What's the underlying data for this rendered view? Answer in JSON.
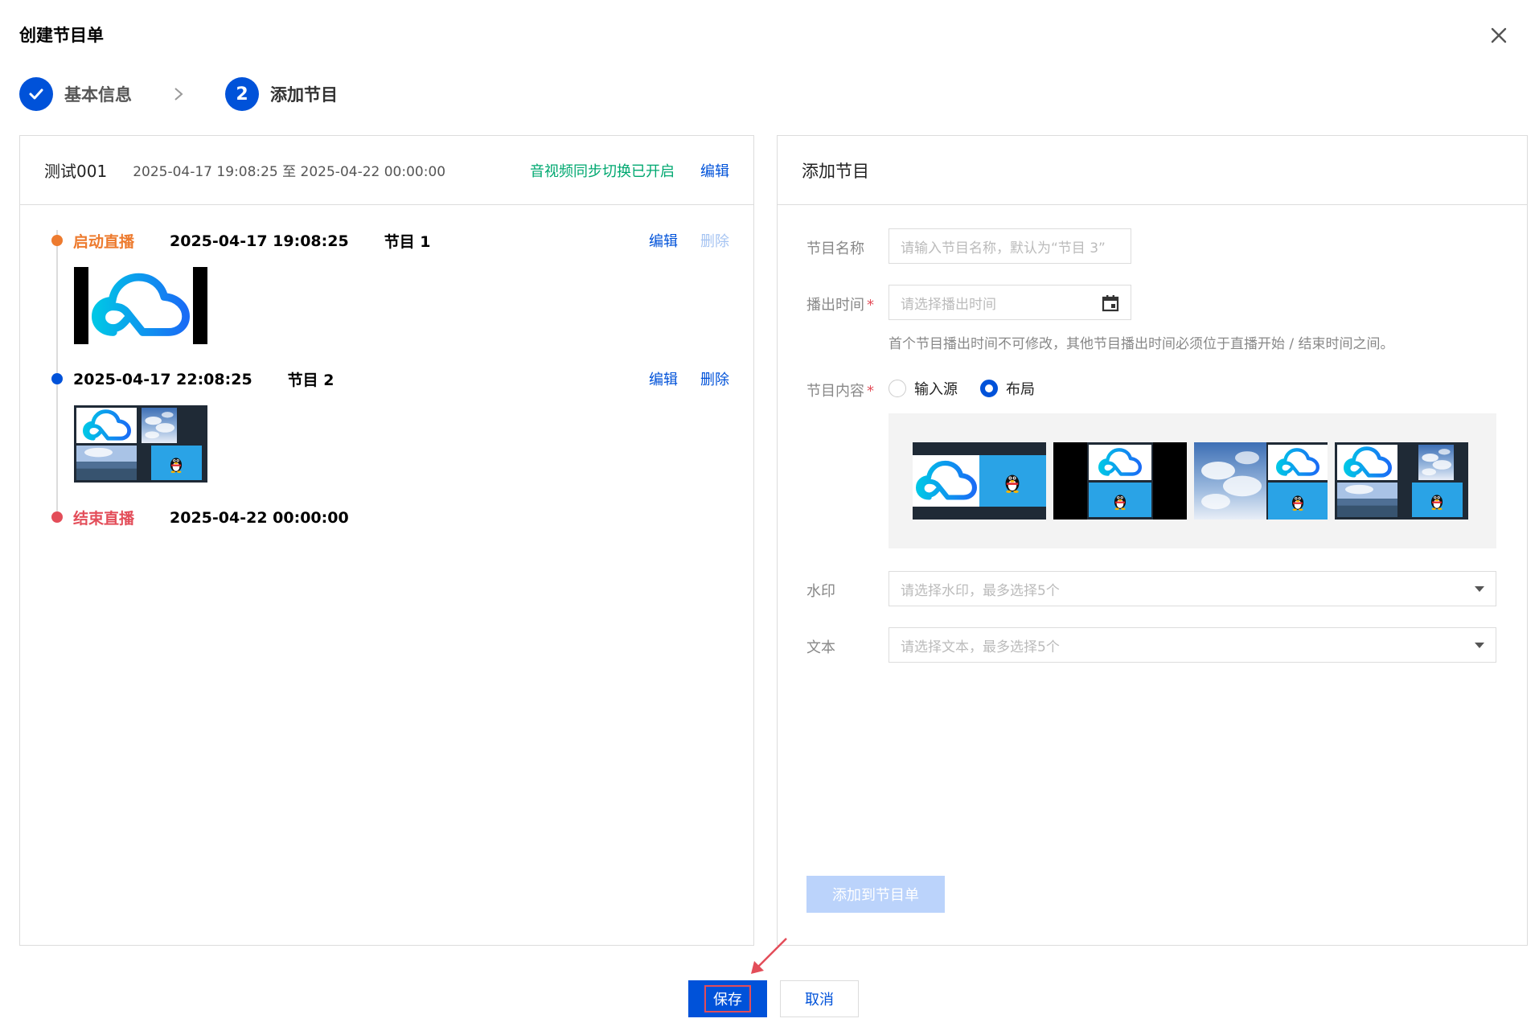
{
  "dialog": {
    "title": "创建节目单"
  },
  "steps": [
    {
      "label": "基本信息",
      "number": "",
      "status": "done"
    },
    {
      "label": "添加节目",
      "number": "2",
      "status": "active"
    }
  ],
  "left": {
    "header": {
      "name": "测试001",
      "range": "2025-04-17 19:08:25 至 2025-04-22 00:00:00",
      "sync_status": "音视频同步切换已开启",
      "edit_label": "编辑"
    },
    "timeline": [
      {
        "tag": "启动直播",
        "time": "2025-04-17 19:08:25",
        "program": "节目 1",
        "edit": "编辑",
        "delete": "删除",
        "color": "#ed7b2f"
      },
      {
        "tag": "",
        "time": "2025-04-17 22:08:25",
        "program": "节目 2",
        "edit": "编辑",
        "delete": "删除",
        "color": "#0052d9"
      },
      {
        "tag": "结束直播",
        "time": "2025-04-22 00:00:00",
        "program": "",
        "color": "#e34d59"
      }
    ]
  },
  "right": {
    "title": "添加节目",
    "name_label": "节目名称",
    "name_placeholder": "请输入节目名称，默认为“节目 3”",
    "time_label": "播出时间",
    "time_placeholder": "请选择播出时间",
    "time_hint": "首个节目播出时间不可修改，其他节目播出时间必须位于直播开始 / 结束时间之间。",
    "content_label": "节目内容",
    "content_options": [
      {
        "label": "输入源",
        "checked": false
      },
      {
        "label": "布局",
        "checked": true
      }
    ],
    "watermark_label": "水印",
    "watermark_placeholder": "请选择水印，最多选择5个",
    "text_label": "文本",
    "text_placeholder": "请选择文本，最多选择5个",
    "add_button": "添加到节目单",
    "required_mark": "*"
  },
  "footer": {
    "save": "保存",
    "cancel": "取消"
  },
  "colors": {
    "primary": "#0052d9",
    "success": "#00a870",
    "warning": "#ed7b2f",
    "error": "#e34d59",
    "border": "#dcdcdc"
  }
}
